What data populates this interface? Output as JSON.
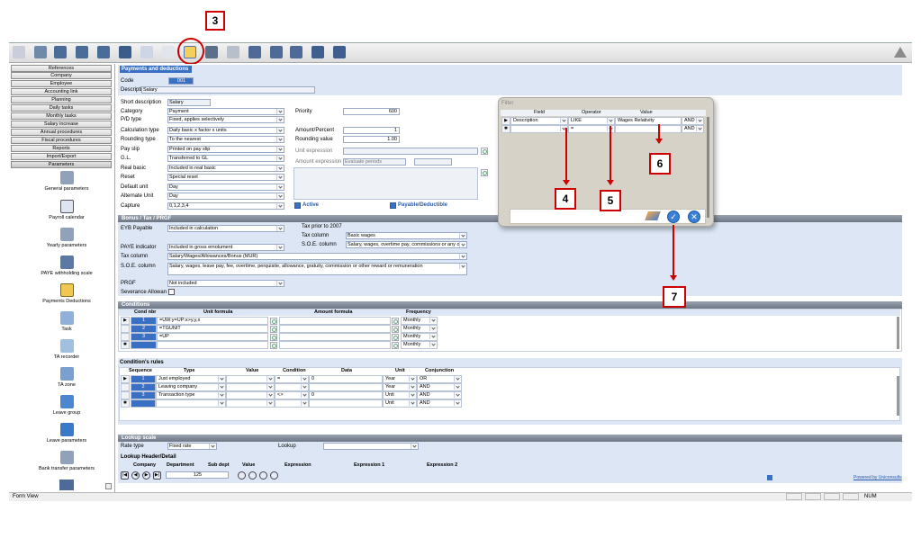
{
  "annotations": {
    "a3": "3",
    "a4": "4",
    "a5": "5",
    "a6": "6",
    "a7": "7"
  },
  "nav": {
    "references": "References",
    "company": "Company",
    "employee": "Employee",
    "accounting_link": "Accounting link",
    "planning": "Planning",
    "daily_tasks": "Daily tasks",
    "monthly_tasks": "Monthly tasks",
    "salary_increase": "Salary increase",
    "annual_procedures": "Annual procedures",
    "fiscal_procedures": "Fiscal procedures",
    "reports": "Reports",
    "import_export": "Import/Export",
    "parameters": "Parameters"
  },
  "params": [
    "General parameters",
    "Payroll calendar",
    "Yearly parameters",
    "PAYE withholding scale",
    "Payments Deductions",
    "Task",
    "TA recorder",
    "TA zone",
    "Leave group",
    "Leave parameters",
    "Bank transfer parameters"
  ],
  "payments": {
    "title": "Payments and deductions",
    "code_label": "Code",
    "code_value": "001",
    "desc_label": "Description",
    "desc_value": "Salary"
  },
  "form": {
    "short_desc_label": "Short description",
    "short_desc": "Salary",
    "category_label": "Category",
    "category": "Payment",
    "pd_type_label": "P/D type",
    "pd_type": "Fixed, applies selectively",
    "calc_type_label": "Calculation type",
    "calc_type": "Daily basic x factor x units",
    "rounding_type_label": "Rounding type",
    "rounding_type": "To the nearest",
    "pay_slip_label": "Pay slip",
    "pay_slip": "Printed on pay slip",
    "gl_label": "G.L.",
    "gl": "Transferred to GL",
    "real_basic_label": "Real basic",
    "real_basic": "Included in real basic",
    "reset_label": "Reset",
    "reset": "Special reset",
    "default_unit_label": "Default unit",
    "default_unit": "Day",
    "alt_unit_label": "Alternate Unit",
    "alt_unit": "Day",
    "capture_label": "Capture",
    "capture": "0,1,2,3,4",
    "priority_label": "Priority",
    "priority": "600",
    "amount_percent_label": "Amount/Percent",
    "amount_percent": "1",
    "rounding_value_label": "Rounding value",
    "rounding_value": "1.00",
    "unit_expr_label": "Unit expression",
    "amount_expr_label": "Amount expression",
    "evaluate_periods": "Evaluate periods",
    "active_label": "Active",
    "payable_label": "Payable/Deductible"
  },
  "bonus": {
    "title": "Bonus / Tax / PRGF",
    "eyb_label": "EYB Payable",
    "eyb": "Included in calculation",
    "tax_prior": "Tax prior to 2007",
    "tax_col_label_r": "Tax column",
    "tax_col_r": "Basic wages",
    "soe_label_r": "S.O.E. column",
    "soe_r": "Salary, wages, overtime pay, commissions or any o...",
    "paye_label": "PAYE indicator",
    "paye": "Included in gross emolument",
    "tax_col_label": "Tax column",
    "tax_col": "Salary/Wages/Allowances/Bonus (MUR)",
    "soe_label": "S.O.E. column",
    "soe": "Salary, wages, leave pay, fee, overtime, perquisite, allowance, gratuity, commission or other reward or remuneration",
    "prgf_label": "PRGF",
    "prgf": "Not included",
    "severance_label": "Severance Allowan"
  },
  "conditions": {
    "title": "Conditions",
    "headers": [
      "Cond nbr",
      "Unit formula",
      "Amount formula",
      "Frequency"
    ],
    "rows": [
      {
        "nbr": "1",
        "unit": "=UW:y=UP:x>y,y,x",
        "freq": "Monthly"
      },
      {
        "nbr": "2",
        "unit": "=TGUNIT",
        "freq": "Monthly"
      },
      {
        "nbr": "3",
        "unit": "=UP",
        "freq": "Monthly"
      },
      {
        "nbr": "",
        "unit": "",
        "freq": "Monthly"
      }
    ]
  },
  "rules": {
    "title": "Condition's rules",
    "headers": [
      "Sequence",
      "Type",
      "Value",
      "Condition",
      "Data",
      "Unit",
      "Conjunction"
    ],
    "rows": [
      {
        "seq": "1",
        "type": "Just employed",
        "cond": "=",
        "data": "0",
        "unit": "Year",
        "conj": "OR"
      },
      {
        "seq": "2",
        "type": "Leaving company",
        "cond": "",
        "data": "",
        "unit": "Year",
        "conj": "AND"
      },
      {
        "seq": "3",
        "type": "Transaction type",
        "cond": "<>",
        "data": "0",
        "unit": "Unit",
        "conj": "AND"
      },
      {
        "seq": "",
        "type": "",
        "cond": "",
        "data": "",
        "unit": "Unit",
        "conj": "AND"
      }
    ]
  },
  "lookup": {
    "title": "Lookup scale",
    "rate_type_label": "Rate type",
    "rate_type": "Fixed rate",
    "lookup_label": "Lookup",
    "header_detail": "Lookup Header/Detail",
    "headers": [
      "Company",
      "Department",
      "Sub dept",
      "Value",
      "Expression",
      "Expression 1",
      "Expression 2"
    ],
    "record": "125",
    "powered": "Powered by Uniconsults"
  },
  "filter": {
    "title": "Filter",
    "headers": [
      "Field",
      "Operator",
      "Value"
    ],
    "rows": [
      {
        "field": "Description",
        "op": "LIKE",
        "value": "Wages Relativity",
        "conj": "AND"
      },
      {
        "field": "",
        "op": "=",
        "value": "",
        "conj": "AND"
      }
    ]
  },
  "status": {
    "left": "Form View",
    "num": "NUM"
  },
  "colors": {
    "accent": "#3a70c4",
    "annotation": "#cc0000",
    "header_bg": "#dce6f4"
  }
}
